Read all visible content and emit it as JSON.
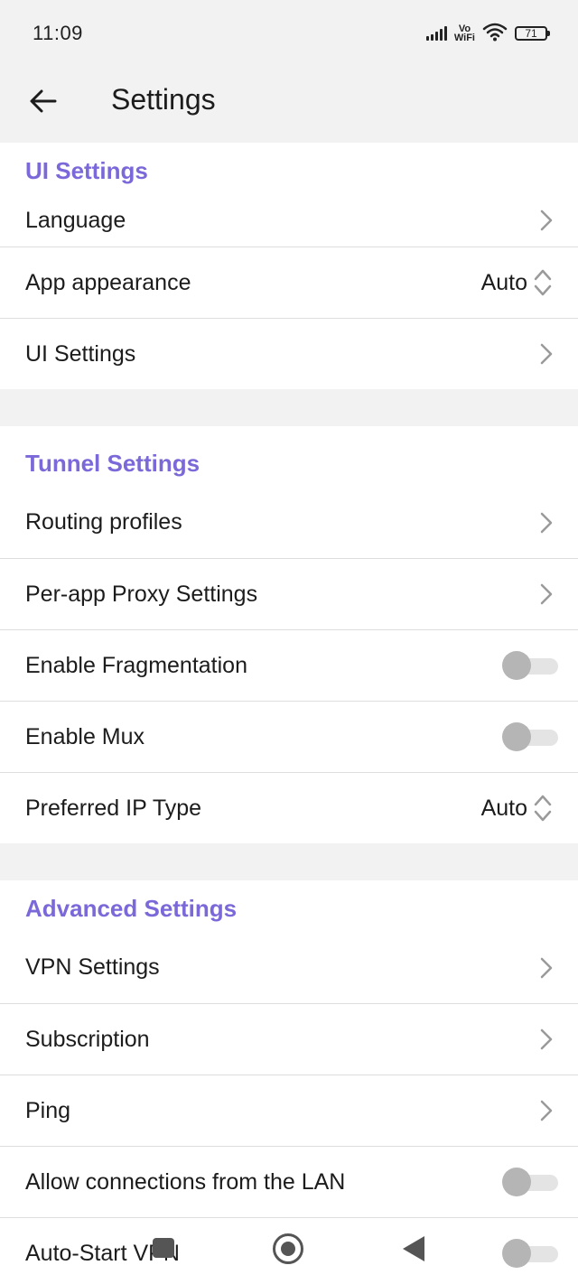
{
  "status_bar": {
    "time": "11:09",
    "vowifi_top": "Vo",
    "vowifi_bottom": "WiFi",
    "battery": "71"
  },
  "app_bar": {
    "title": "Settings"
  },
  "sections": {
    "ui": {
      "header": "UI Settings",
      "language": "Language",
      "app_appearance": "App appearance",
      "app_appearance_value": "Auto",
      "ui_settings": "UI Settings"
    },
    "tunnel": {
      "header": "Tunnel Settings",
      "routing_profiles": "Routing profiles",
      "per_app_proxy": "Per-app Proxy Settings",
      "fragmentation": "Enable Fragmentation",
      "fragmentation_on": false,
      "mux": "Enable Mux",
      "mux_on": false,
      "preferred_ip": "Preferred IP Type",
      "preferred_ip_value": "Auto"
    },
    "advanced": {
      "header": "Advanced Settings",
      "vpn_settings": "VPN Settings",
      "subscription": "Subscription",
      "ping": "Ping",
      "allow_lan": "Allow connections from the LAN",
      "allow_lan_on": false,
      "auto_start": "Auto-Start VPN",
      "auto_start_on": false
    }
  },
  "colors": {
    "accent": "#7b68d9",
    "background": "#f2f2f2",
    "surface": "#ffffff",
    "divider": "#dedede",
    "toggle_thumb_off": "#b5b5b5",
    "toggle_track_off": "#e4e4e4"
  },
  "icons": {
    "back": "arrow-left-icon",
    "chevron": "chevron-right-icon",
    "updown": "chevron-up-down-icon"
  }
}
